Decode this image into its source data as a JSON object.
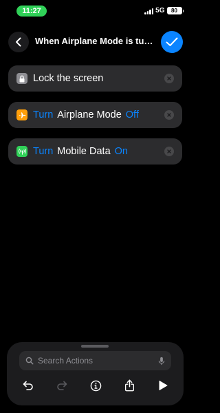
{
  "status": {
    "time": "11:27",
    "network": "5G",
    "battery": "80"
  },
  "header": {
    "title": "When Airplane Mode is turne..."
  },
  "actions": [
    {
      "text": "Lock the screen",
      "icon": "lock-icon",
      "color": "#8e8e93"
    },
    {
      "verb": "Turn",
      "object": "Airplane Mode",
      "state": "Off",
      "icon": "airplane-icon",
      "color": "#ff9f0a"
    },
    {
      "verb": "Turn",
      "object": "Mobile Data",
      "state": "On",
      "icon": "cellular-icon",
      "color": "#30d158"
    }
  ],
  "search": {
    "placeholder": "Search Actions"
  },
  "toolbar": [
    "undo-icon",
    "redo-icon",
    "info-icon",
    "share-icon",
    "play-icon"
  ],
  "colors": {
    "accent": "#0a84ff",
    "time_pill": "#30d158",
    "card": "#2c2c2e"
  }
}
